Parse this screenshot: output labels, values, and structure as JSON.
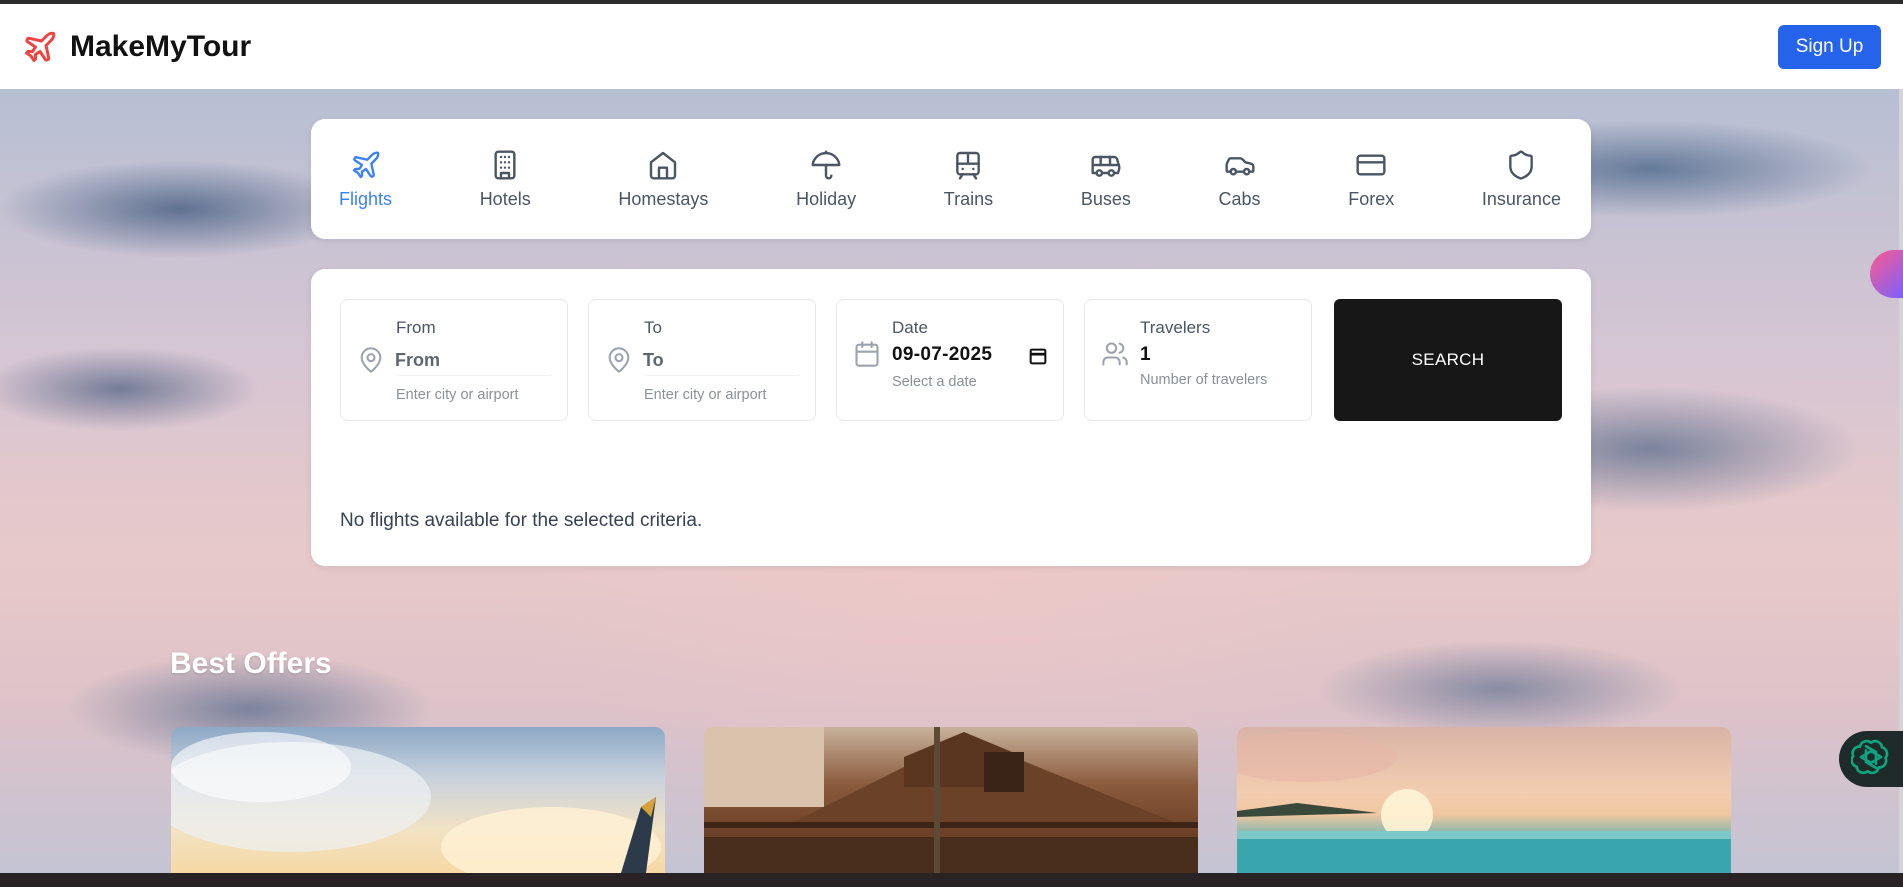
{
  "header": {
    "brand_name": "MakeMyTour",
    "signup_label": "Sign Up"
  },
  "tabs": [
    {
      "label": "Flights",
      "icon": "plane-icon",
      "active": true
    },
    {
      "label": "Hotels",
      "icon": "building-icon",
      "active": false
    },
    {
      "label": "Homestays",
      "icon": "home-icon",
      "active": false
    },
    {
      "label": "Holiday",
      "icon": "umbrella-icon",
      "active": false
    },
    {
      "label": "Trains",
      "icon": "train-icon",
      "active": false
    },
    {
      "label": "Buses",
      "icon": "bus-icon",
      "active": false
    },
    {
      "label": "Cabs",
      "icon": "car-icon",
      "active": false
    },
    {
      "label": "Forex",
      "icon": "card-icon",
      "active": false
    },
    {
      "label": "Insurance",
      "icon": "shield-icon",
      "active": false
    }
  ],
  "search": {
    "from": {
      "label": "From",
      "placeholder": "From",
      "help": "Enter city or airport"
    },
    "to": {
      "label": "To",
      "placeholder": "To",
      "help": "Enter city or airport"
    },
    "date": {
      "label": "Date",
      "value": "09-07-2025",
      "help": "Select a date"
    },
    "travelers": {
      "label": "Travelers",
      "value": "1",
      "help": "Number of travelers"
    },
    "button_label": "SEARCH",
    "no_results": "No flights available for the selected criteria."
  },
  "offers": {
    "title": "Best Offers"
  },
  "colors": {
    "accent": "#3b82f6",
    "signup": "#2563eb",
    "brand_icon": "#ef4444",
    "search_button": "#171717"
  }
}
